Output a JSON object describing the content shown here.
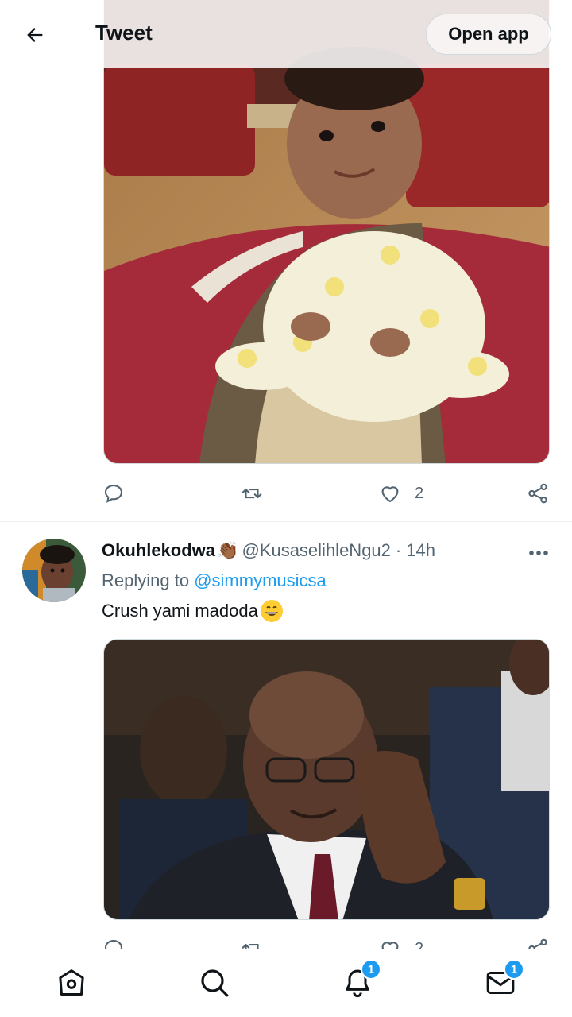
{
  "header": {
    "title": "Tweet",
    "open_app_label": "Open app"
  },
  "first_tweet": {
    "media_alt": "baby sitting on a rug",
    "like_count": "2"
  },
  "reply": {
    "name": "Okuhlekodwa",
    "name_emoji": "👏🏾",
    "handle": "@KusaselihleNgu2",
    "separator": "·",
    "time": "14h",
    "replying_prefix": "Replying to",
    "replying_to": "@simmymusicsa",
    "text": "Crush yami madoda",
    "text_emoji": "grinning-face",
    "media_alt": "man in suit with hands pressed together",
    "like_count": "2"
  },
  "bottom_nav": {
    "items": [
      "home",
      "search",
      "notifications",
      "messages"
    ],
    "notifications_badge": "1",
    "messages_badge": "1"
  },
  "colors": {
    "accent": "#1d9bf0",
    "secondary_text": "#536471",
    "primary_text": "#0f1419"
  }
}
